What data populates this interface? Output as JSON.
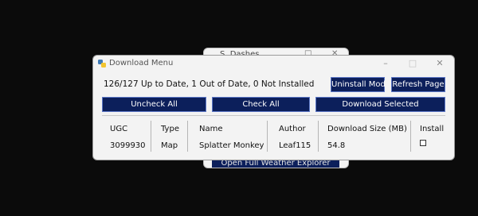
{
  "background_window": {
    "title": "S. Dashes",
    "button_label": "Open Full Weather Explorer"
  },
  "window": {
    "title": "Download Menu",
    "icon": "python-icon",
    "controls": {
      "minimize": "–",
      "maximize": "□",
      "close": "✕"
    }
  },
  "status_text": "126/127 Up to Date, 1 Out of Date, 0 Not Installed",
  "buttons": {
    "uninstall_mod": "Uninstall Mod",
    "refresh_page": "Refresh Page",
    "uncheck_all": "Uncheck All",
    "check_all": "Check All",
    "download_selected": "Download Selected"
  },
  "table": {
    "headers": [
      "UGC",
      "Type",
      "Name",
      "Author",
      "Download Size (MB)",
      "Install"
    ],
    "rows": [
      {
        "ugc": "3099930",
        "type": "Map",
        "name": "Splatter Monkey",
        "author": "Leaf115",
        "size": "54.8",
        "install": false
      }
    ]
  },
  "colors": {
    "button_bg": "#0c1f5b",
    "window_bg": "#f3f3f3",
    "desktop_bg": "#0b0b0b"
  }
}
